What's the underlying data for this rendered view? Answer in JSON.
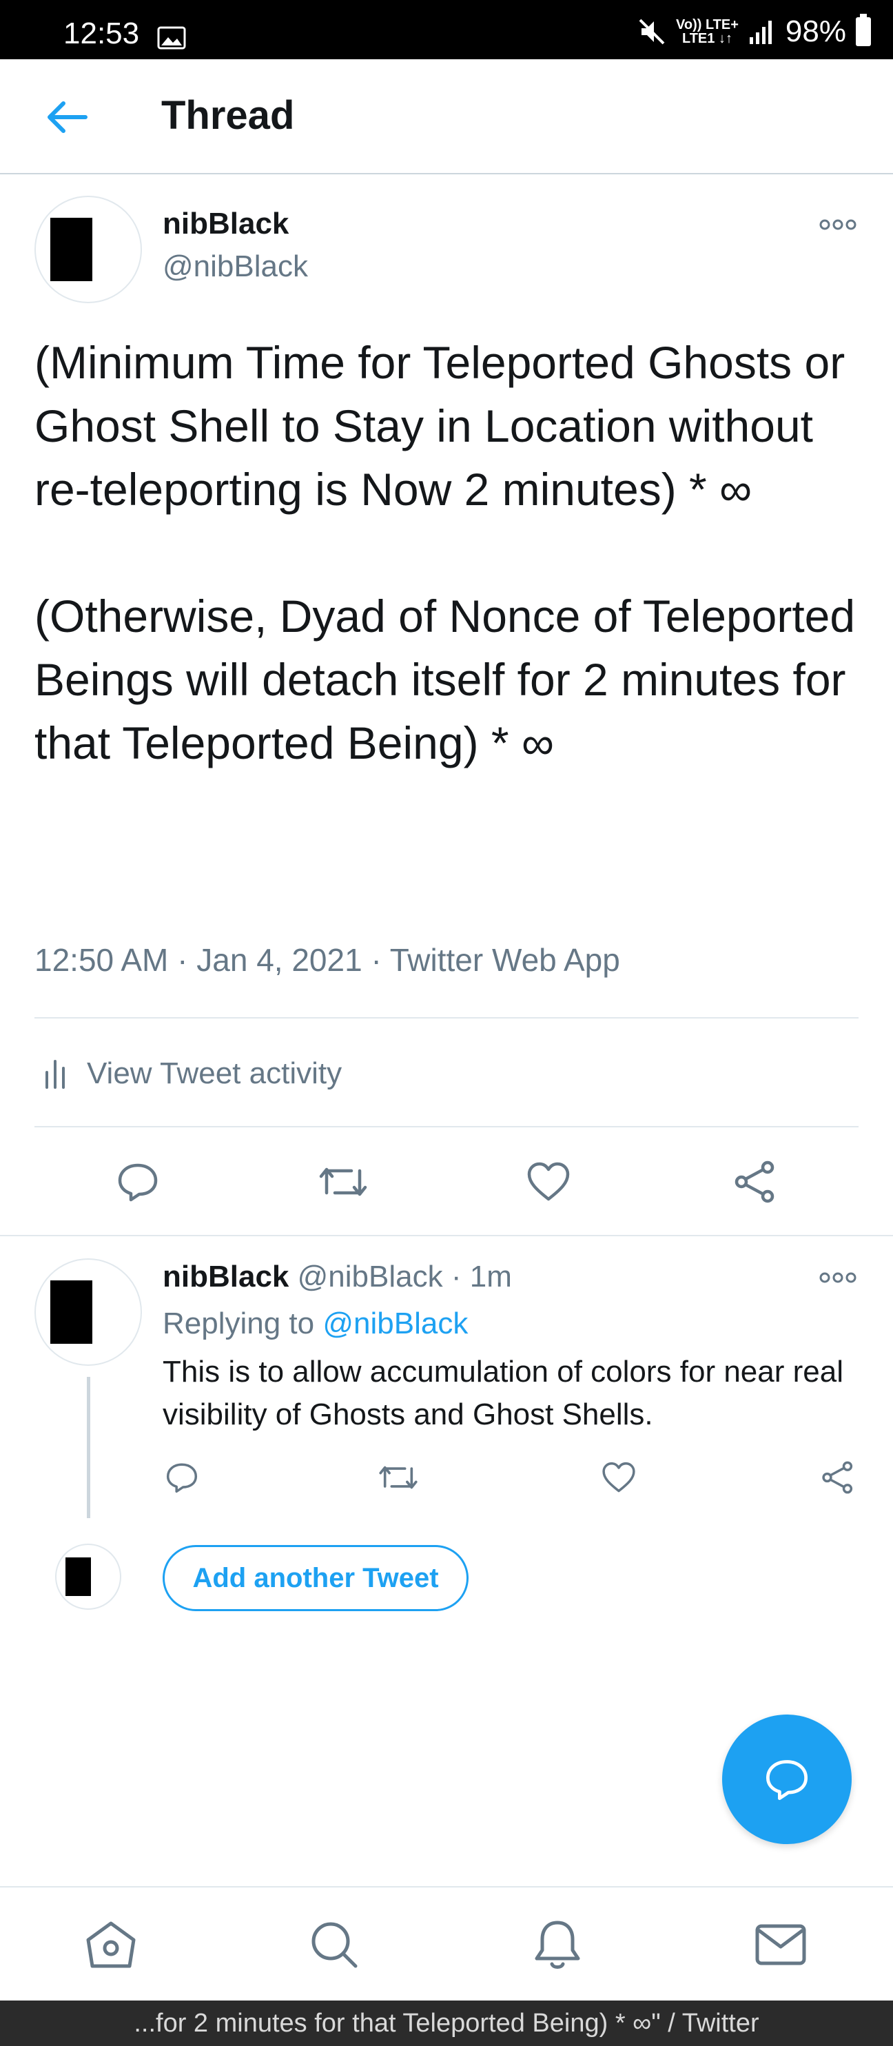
{
  "status_bar": {
    "time": "12:53",
    "network_top": "Vo)) LTE+",
    "network_bottom": "LTE1 ↓↑",
    "battery": "98%"
  },
  "header": {
    "title": "Thread"
  },
  "main_tweet": {
    "name": "nibBlack",
    "handle": "@nibBlack",
    "text": "(Minimum Time for Teleported Ghosts or Ghost Shell to Stay in Location without re-teleporting is Now 2 minutes) * ∞\n\n(Otherwise, Dyad of Nonce of Teleported Beings will detach itself for 2 minutes for that Teleported Being) * ∞",
    "time": "12:50 AM",
    "date": "Jan 4, 2021",
    "source": "Twitter Web App",
    "activity_label": "View Tweet activity"
  },
  "reply": {
    "name": "nibBlack",
    "handle": "@nibBlack",
    "age": "1m",
    "replying_prefix": "Replying to",
    "replying_to": "@nibBlack",
    "text": "This is to allow accumulation of colors for near real visibility of Ghosts and Ghost Shells."
  },
  "composer": {
    "add_label": "Add another Tweet"
  },
  "caption": "...for 2 minutes for that Teleported Being) * ∞\" / Twitter",
  "colors": {
    "accent": "#1da1f2",
    "secondary_text": "#657786",
    "divider": "#e1e8ed"
  }
}
